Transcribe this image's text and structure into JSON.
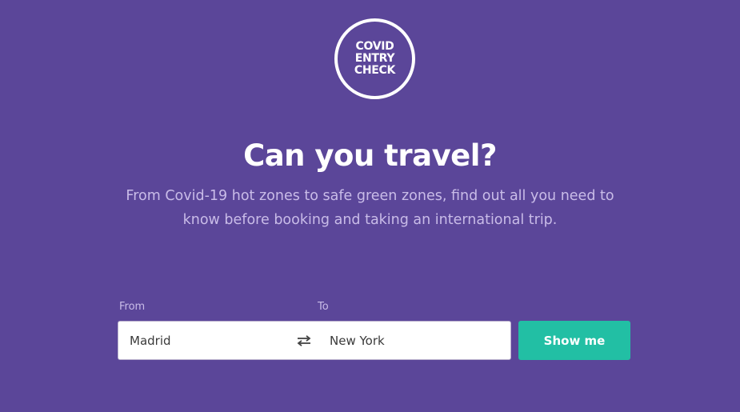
{
  "logo": {
    "line1": "COVID",
    "line2": "ENTRY",
    "line3": "CHECK"
  },
  "hero": {
    "title": "Can you travel?",
    "subtitle": "From Covid-19 hot zones to safe green zones, find out all you need to know before booking and taking an international trip."
  },
  "search": {
    "from_label": "From",
    "from_value": "Madrid",
    "to_label": "To",
    "to_value": "New York",
    "swap_icon": "swap-arrows-icon",
    "submit_label": "Show me"
  },
  "colors": {
    "background": "#5b4699",
    "accent": "#22bfa4",
    "subtitle_text": "#c9bce8"
  }
}
